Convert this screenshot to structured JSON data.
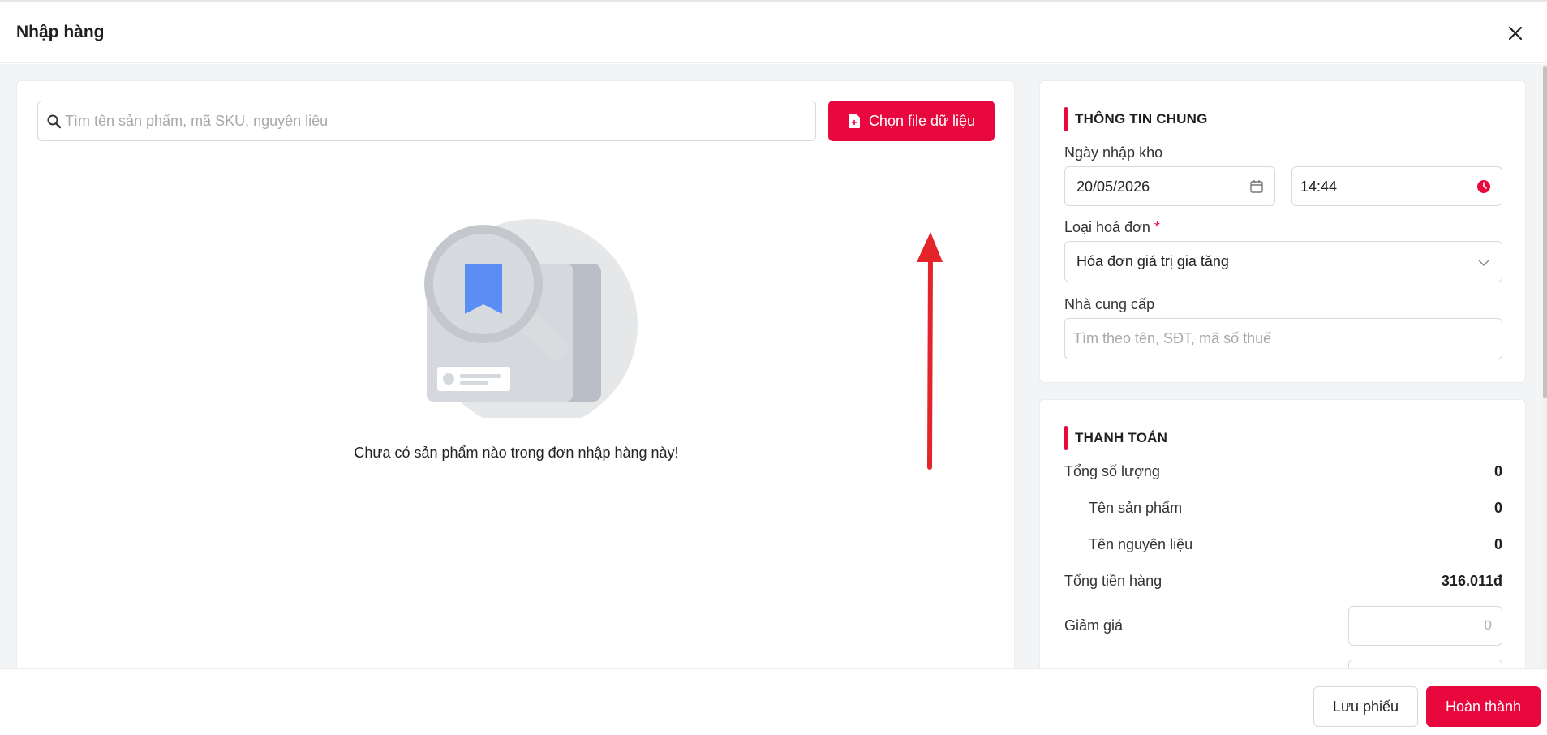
{
  "header": {
    "title": "Nhập hàng"
  },
  "search": {
    "placeholder": "Tìm tên sản phẩm, mã SKU, nguyên liệu"
  },
  "file_button": {
    "label": "Chọn file dữ liệu"
  },
  "empty_state": {
    "message": "Chưa có sản phẩm nào trong đơn nhập hàng này!"
  },
  "general": {
    "section_title": "THÔNG TIN CHUNG",
    "import_date_label": "Ngày nhập kho",
    "date_value": "20/05/2026",
    "time_value": "14:44",
    "invoice_type_label": "Loại hoá đơn",
    "required_mark": "*",
    "invoice_type_value": "Hóa đơn giá trị gia tăng",
    "supplier_label": "Nhà cung cấp",
    "supplier_placeholder": "Tìm theo tên, SĐT, mã số thuế"
  },
  "payment": {
    "section_title": "THANH TOÁN",
    "rows": [
      {
        "label": "Tổng số lượng",
        "value": "0"
      },
      {
        "label": "Tên sản phẩm",
        "value": "0"
      },
      {
        "label": "Tên nguyên liệu",
        "value": "0"
      },
      {
        "label": "Tổng tiền hàng",
        "value": "316.011đ"
      }
    ],
    "discount_label": "Giảm giá",
    "discount_value": "0"
  },
  "footer": {
    "save_label": "Lưu phiếu",
    "done_label": "Hoàn thành"
  },
  "colors": {
    "accent": "#e8083e",
    "panel_bg": "#f3f4f6",
    "border": "#d9d9d9"
  },
  "icons": [
    "close-icon",
    "search-icon",
    "file-icon",
    "calendar-icon",
    "clock-icon",
    "chevron-down-icon",
    "empty-box-illustration",
    "up-arrow-annotation"
  ]
}
